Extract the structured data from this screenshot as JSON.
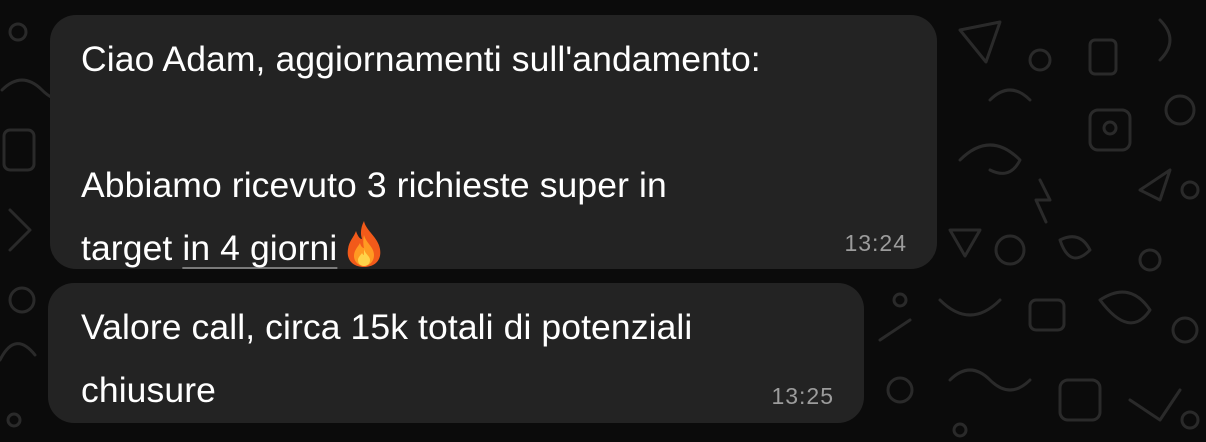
{
  "messages": [
    {
      "line1": "Ciao Adam, aggiornamenti sull'andamento:",
      "line2": "",
      "line3": "Abbiamo ricevuto 3 richieste super in",
      "line4_prefix": "target ",
      "line4_link": "in 4 giorni",
      "emoji": "fire-emoji",
      "time": "13:24"
    },
    {
      "line1": "Valore call, circa 15k totali di potenziali",
      "line2": "chiusure",
      "time": "13:25"
    }
  ],
  "colors": {
    "background": "#0b0b0b",
    "bubble": "#232323",
    "text": "#ffffff",
    "timestamp": "#9c9c9c",
    "wallpaper_doodle": "#2a2a2a"
  }
}
